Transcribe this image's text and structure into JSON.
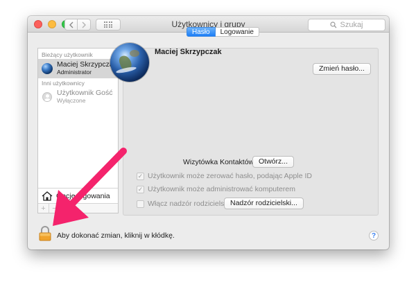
{
  "window": {
    "title": "Użytkownicy i grupy",
    "search_placeholder": "Szukaj",
    "nav": {
      "back_icon": "chevron-left-icon",
      "forward_icon": "chevron-right-icon",
      "grid_icon": "grid-icon"
    }
  },
  "sidebar": {
    "current_header": "Bieżący użytkownik",
    "current_user": {
      "name": "Maciej Skrzypczak",
      "role": "Administrator"
    },
    "others_header": "Inni użytkownicy",
    "guest_user": {
      "name": "Użytkownik Gość",
      "status": "Wyłączone"
    },
    "login_options": "Opcje logowania",
    "add_label": "+",
    "remove_label": "−"
  },
  "tabs": [
    {
      "label": "Hasło",
      "active": true
    },
    {
      "label": "Logowanie",
      "active": false
    }
  ],
  "panel": {
    "full_name": "Maciej Skrzypczak",
    "change_password_button": "Zmień hasło...",
    "contact_card_label": "Wizytówka Kontaktów:",
    "open_button": "Otwórz...",
    "checkboxes": [
      {
        "label": "Użytkownik może zerować hasło, podając Apple ID",
        "checked": true,
        "enabled": false
      },
      {
        "label": "Użytkownik może administrować komputerem",
        "checked": true,
        "enabled": false
      },
      {
        "label": "Włącz nadzór rodzicielski",
        "checked": false,
        "enabled": false
      }
    ],
    "parental_controls_button": "Nadzór rodzicielski..."
  },
  "footer": {
    "lock_text": "Aby dokonać zmian, kliknij w kłódkę.",
    "help_label": "?"
  },
  "colors": {
    "accent": "#1c7ef6",
    "annotation_arrow": "#f4236c",
    "lock": "#f0a32c"
  }
}
